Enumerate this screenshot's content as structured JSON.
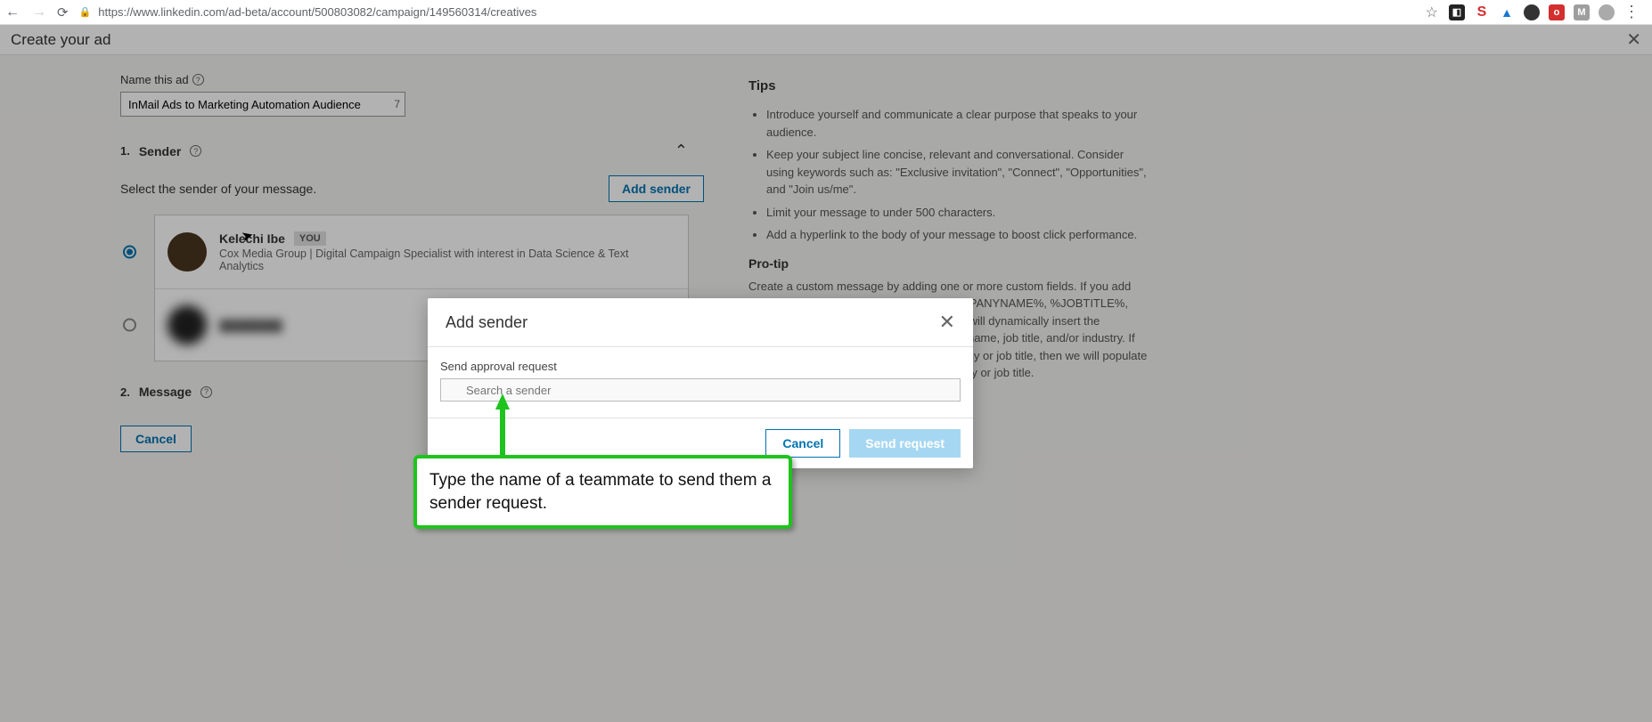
{
  "browser": {
    "url": "https://www.linkedin.com/ad-beta/account/500803082/campaign/149560314/creatives"
  },
  "header": {
    "title": "Create your ad"
  },
  "ad_name": {
    "label": "Name this ad",
    "value": "InMail Ads to Marketing Automation Audience",
    "counter": "7"
  },
  "sender_section": {
    "num": "1.",
    "title": "Sender",
    "subtext": "Select the sender of your message.",
    "add_button": "Add sender"
  },
  "senders": [
    {
      "name": "Kelechi Ibe",
      "you": "YOU",
      "desc": "Cox Media Group | Digital Campaign Specialist with interest in Data Science & Text Analytics"
    }
  ],
  "message_section": {
    "num": "2.",
    "title": "Message"
  },
  "cancel_button": "Cancel",
  "tips": {
    "title": "Tips",
    "items": [
      "Introduce yourself and communicate a clear purpose that speaks to your audience.",
      "Keep your subject line concise, relevant and conversational. Consider using keywords such as: \"Exclusive invitation\", \"Connect\", \"Opportunities\", and \"Join us/me\".",
      "Limit your message to under 500 characters.",
      "Add a hyperlink to the body of your message to boost click performance."
    ],
    "protip_title": "Pro-tip",
    "protip_text": "Create a custom message by adding one or more custom fields. If you add %FIRSTNAME%, %LASTNAME%, %COMPANYNAME%, %JOBTITLE%, and/or %INDUSTRY%, then these macros will dynamically insert the recipient's first name, last name, company name, job title, and/or industry. If the user has more than one current company or job title, then we will populate the recipient's most recently added company or job title."
  },
  "modal": {
    "title": "Add sender",
    "field_label": "Send approval request",
    "placeholder": "Search a sender",
    "cancel": "Cancel",
    "send": "Send request"
  },
  "callout": {
    "text": "Type the name of a teammate to send them a sender request."
  }
}
